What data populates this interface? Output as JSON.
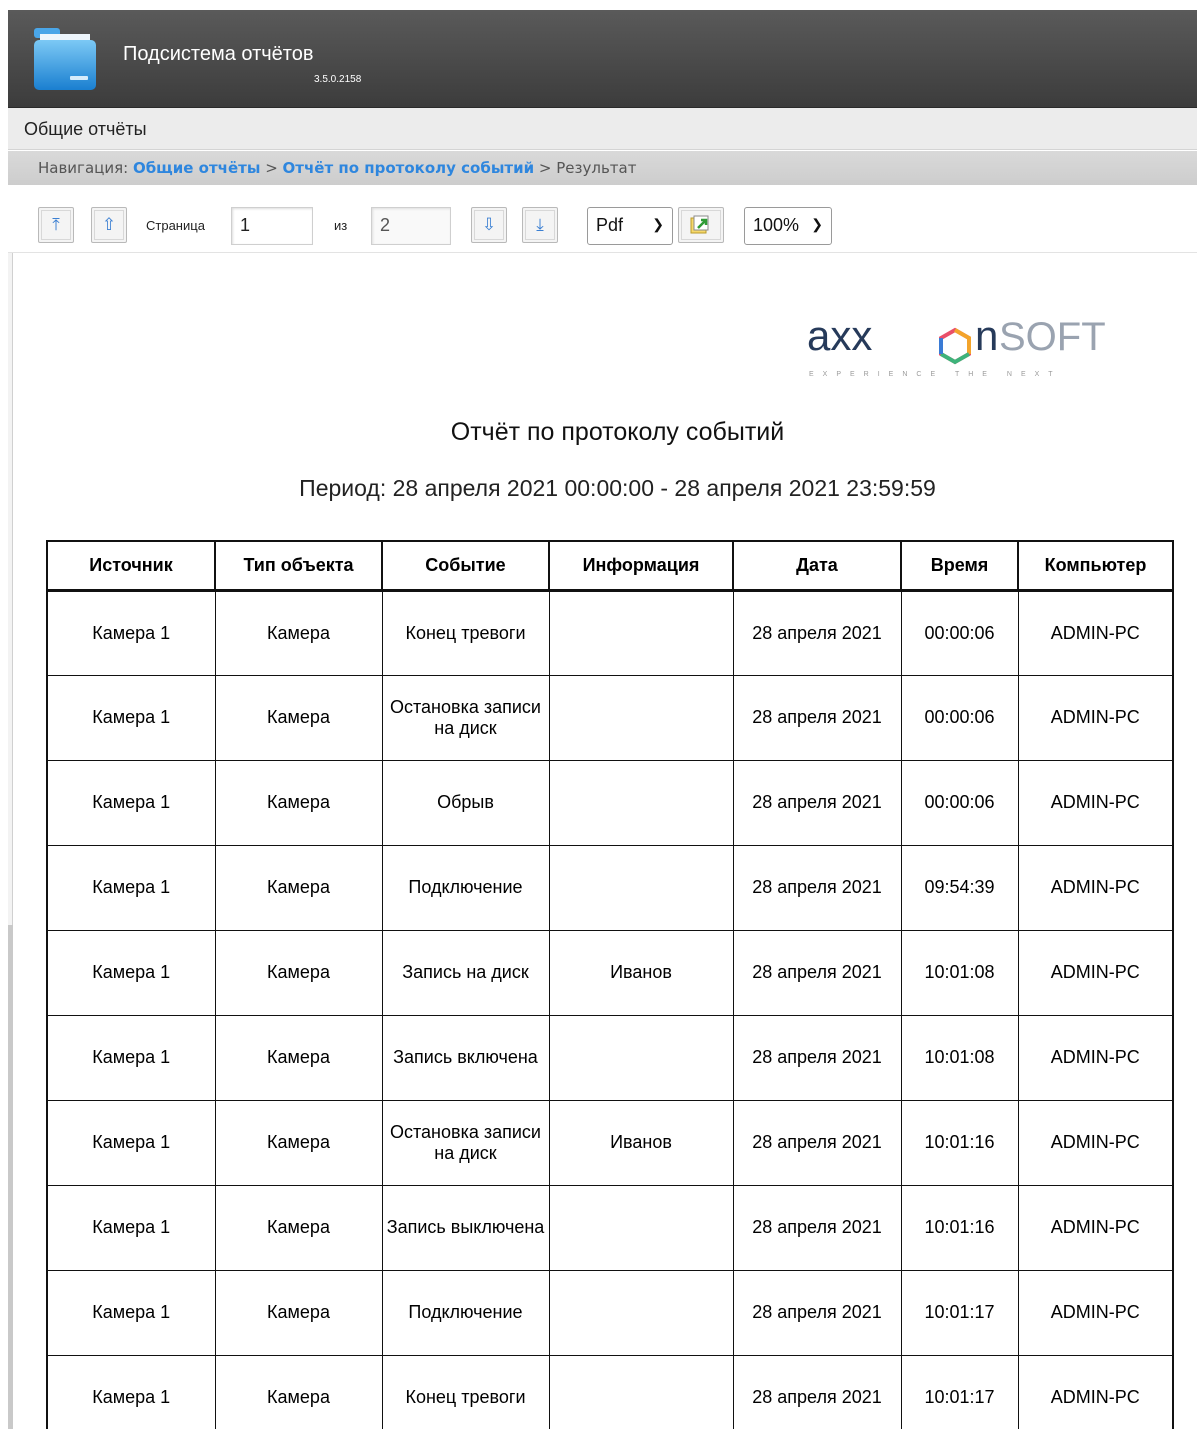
{
  "app": {
    "title": "Подсистема отчётов",
    "version": "3.5.0.2158"
  },
  "menu": {
    "general_reports": "Общие отчёты"
  },
  "breadcrumb": {
    "prefix": "Навигация:",
    "link1": "Общие отчёты",
    "sep1": ">",
    "link2": "Отчёт по протоколу событий",
    "sep2": ">",
    "current": "Результат"
  },
  "toolbar": {
    "page_label": "Страница",
    "page_value": "1",
    "of_label": "из",
    "total_pages": "2",
    "format_selected": "Pdf",
    "zoom_selected": "100%",
    "icons": {
      "first": "first-page-icon",
      "prev": "prev-page-icon",
      "next": "next-page-icon",
      "last": "last-page-icon",
      "export": "export-icon"
    }
  },
  "report": {
    "logo_text": "axxonsoft",
    "logo_tagline": "EXPERIENCE THE NEXT",
    "title": "Отчёт по протоколу событий",
    "period": "Период: 28 апреля 2021 00:00:00 - 28 апреля 2021 23:59:59",
    "columns": [
      "Источник",
      "Тип объекта",
      "Событие",
      "Информация",
      "Дата",
      "Время",
      "Компьютер"
    ],
    "rows": [
      [
        "Камера 1",
        "Камера",
        "Конец тревоги",
        "",
        "28 апреля 2021",
        "00:00:06",
        "ADMIN-PC"
      ],
      [
        "Камера 1",
        "Камера",
        "Остановка записи на диск",
        "",
        "28 апреля 2021",
        "00:00:06",
        "ADMIN-PC"
      ],
      [
        "Камера 1",
        "Камера",
        "Обрыв",
        "",
        "28 апреля 2021",
        "00:00:06",
        "ADMIN-PC"
      ],
      [
        "Камера 1",
        "Камера",
        "Подключение",
        "",
        "28 апреля 2021",
        "09:54:39",
        "ADMIN-PC"
      ],
      [
        "Камера 1",
        "Камера",
        "Запись на диск",
        "Иванов",
        "28 апреля 2021",
        "10:01:08",
        "ADMIN-PC"
      ],
      [
        "Камера 1",
        "Камера",
        "Запись включена",
        "",
        "28 апреля 2021",
        "10:01:08",
        "ADMIN-PC"
      ],
      [
        "Камера 1",
        "Камера",
        "Остановка записи на диск",
        "Иванов",
        "28 апреля 2021",
        "10:01:16",
        "ADMIN-PC"
      ],
      [
        "Камера 1",
        "Камера",
        "Запись выключена",
        "",
        "28 апреля 2021",
        "10:01:16",
        "ADMIN-PC"
      ],
      [
        "Камера 1",
        "Камера",
        "Подключение",
        "",
        "28 апреля 2021",
        "10:01:17",
        "ADMIN-PC"
      ],
      [
        "Камера 1",
        "Камера",
        "Конец тревоги",
        "",
        "28 апреля 2021",
        "10:01:17",
        "ADMIN-PC"
      ]
    ]
  }
}
